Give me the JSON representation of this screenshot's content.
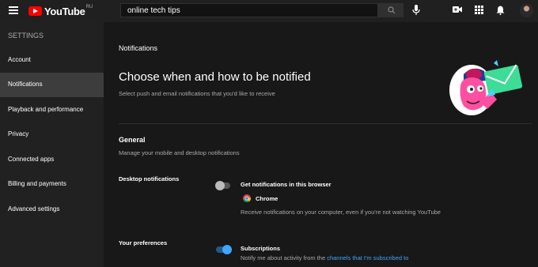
{
  "header": {
    "logo_text": "YouTube",
    "logo_region": "RU",
    "search_value": "online tech tips",
    "icons": [
      "menu-icon",
      "youtube-logo",
      "search-icon",
      "mic-icon",
      "create-video-icon",
      "apps-icon",
      "bell-icon",
      "avatar"
    ]
  },
  "sidebar": {
    "heading": "SETTINGS",
    "items": [
      {
        "label": "Account"
      },
      {
        "label": "Notifications",
        "active": true
      },
      {
        "label": "Playback and performance"
      },
      {
        "label": "Privacy"
      },
      {
        "label": "Connected apps"
      },
      {
        "label": "Billing and payments"
      },
      {
        "label": "Advanced settings"
      }
    ]
  },
  "main": {
    "section_label": "Notifications",
    "title": "Choose when and how to be notified",
    "subtitle": "Select push and email notifications that you'd like to receive",
    "general": {
      "title": "General",
      "subtitle": "Manage your mobile and desktop notifications"
    },
    "desktop": {
      "label": "Desktop notifications",
      "toggle_on": false,
      "option_title": "Get notifications in this browser",
      "browser_name": "Chrome",
      "description": "Receive notifications on your computer, even if you're not watching YouTube"
    },
    "preferences": {
      "label": "Your preferences",
      "toggle_on": true,
      "option_title": "Subscriptions",
      "description_prefix": "Notify me about activity from the ",
      "description_link": "channels that I'm subscribed to"
    }
  },
  "colors": {
    "accent_blue": "#3ea6ff",
    "brand_red": "#ff0000",
    "toggle_on_knob": "#3ea6ff",
    "toggle_on_track": "#1f5a8a"
  }
}
